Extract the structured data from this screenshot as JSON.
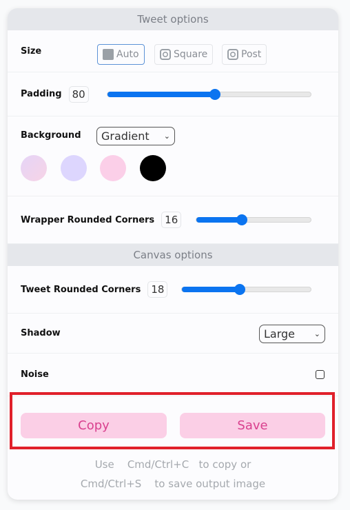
{
  "tweet_options": {
    "title": "Tweet options",
    "size": {
      "label": "Size",
      "options": [
        {
          "label": "Auto",
          "icon": "image-icon"
        },
        {
          "label": "Square",
          "icon": "instagram-icon"
        },
        {
          "label": "Post",
          "icon": "instagram-icon"
        }
      ],
      "selected": "Auto"
    },
    "padding": {
      "label": "Padding",
      "value": "80",
      "fraction": 0.53
    },
    "background": {
      "label": "Background",
      "select": "Gradient",
      "swatches": [
        "linear-gradient(135deg,#e5d5f7,#f7d3e6)",
        "#ddd6fe",
        "#fbcfe8",
        "#000000"
      ]
    },
    "wrapper_corners": {
      "label": "Wrapper Rounded Corners",
      "value": "16",
      "fraction": 0.4
    }
  },
  "canvas_options": {
    "title": "Canvas options",
    "tweet_corners": {
      "label": "Tweet Rounded Corners",
      "value": "18",
      "fraction": 0.45
    },
    "shadow": {
      "label": "Shadow",
      "select": "Large"
    },
    "noise": {
      "label": "Noise",
      "checked": false
    }
  },
  "actions": {
    "copy": "Copy",
    "save": "Save"
  },
  "hint": {
    "line1": [
      "Use",
      "Cmd/Ctrl+C",
      "to copy or"
    ],
    "line2": [
      "Cmd/Ctrl+S",
      "to save output image"
    ]
  },
  "colors": {
    "accent": "#0b74f0",
    "button_bg": "#fbcfe6",
    "button_text": "#d9408e",
    "highlight": "#e0202a"
  }
}
